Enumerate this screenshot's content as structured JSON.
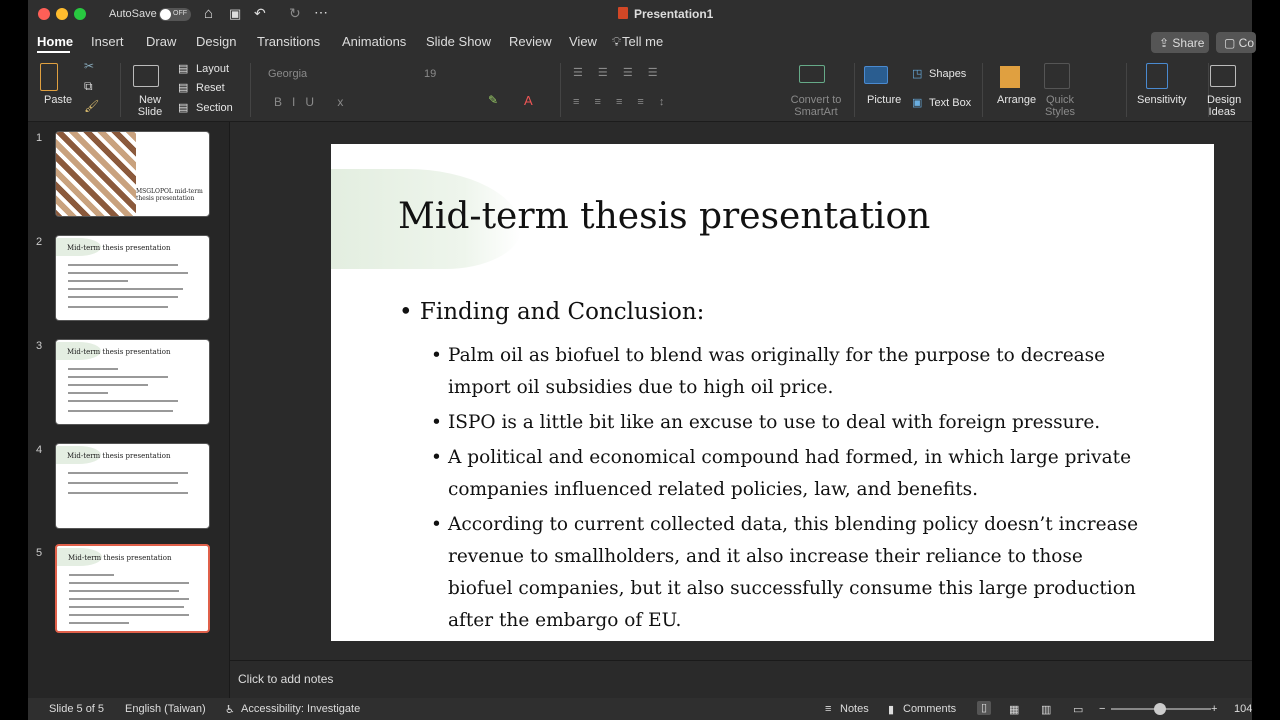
{
  "titlebar": {
    "autosave": "AutoSave",
    "autosave_state": "OFF",
    "doc_title": "Presentation1"
  },
  "tabs": [
    "Home",
    "Insert",
    "Draw",
    "Design",
    "Transitions",
    "Animations",
    "Slide Show",
    "Review",
    "View"
  ],
  "tell_me": "Tell me",
  "share": "Share",
  "comments_btn": "Co",
  "ribbon": {
    "paste": "Paste",
    "new_slide": "New Slide",
    "layout": "Layout",
    "reset": "Reset",
    "section": "Section",
    "font": "Georgia",
    "size": "19",
    "convert": "Convert to SmartArt",
    "picture": "Picture",
    "shapes": "Shapes",
    "textbox": "Text Box",
    "arrange": "Arrange",
    "quick_styles": "Quick Styles",
    "sensitivity": "Sensitivity",
    "design_ideas": "Design Ideas"
  },
  "thumbnails": [
    {
      "n": "1",
      "title": "MSGLOPOL mid-term thesis presentation"
    },
    {
      "n": "2",
      "title": "Mid-term thesis presentation"
    },
    {
      "n": "3",
      "title": "Mid-term thesis presentation"
    },
    {
      "n": "4",
      "title": "Mid-term thesis presentation"
    },
    {
      "n": "5",
      "title": "Mid-term thesis presentation"
    }
  ],
  "slide": {
    "title": "Mid-term thesis presentation",
    "heading": "Finding and Conclusion:",
    "bullets": [
      "Palm oil as biofuel to blend was originally for the purpose to decrease import oil subsidies due to high oil price.",
      "ISPO is a little bit like an excuse to use to deal with foreign pressure.",
      "A political and economical compound had formed, in which large private companies influenced related policies, law, and benefits.",
      "According to current collected data, this blending policy doesn’t increase revenue to smallholders, and it also increase their reliance to those biofuel companies, but it also successfully consume this large production after the embargo of EU."
    ]
  },
  "notes_placeholder": "Click to add notes",
  "status": {
    "slide": "Slide 5 of 5",
    "language": "English (Taiwan)",
    "accessibility": "Accessibility: Investigate",
    "notes": "Notes",
    "comments": "Comments",
    "zoom": "104"
  }
}
